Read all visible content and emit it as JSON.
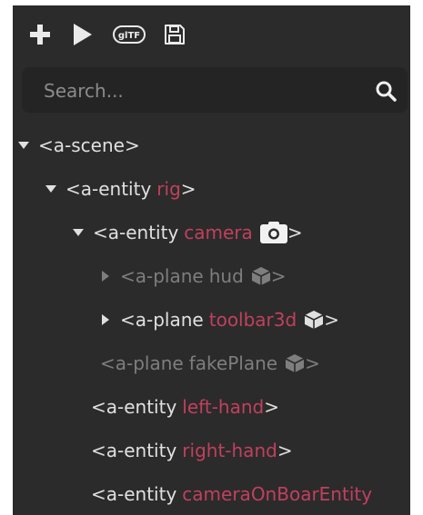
{
  "toolbar": {
    "add_icon": "plus-icon",
    "play_icon": "play-icon",
    "gltf_icon_text": "glTF",
    "save_icon": "floppy-disk-icon"
  },
  "search": {
    "placeholder": "Search..."
  },
  "tree": {
    "nodes": [
      {
        "open": "<",
        "tag": "a-scene",
        "name": "",
        "close": ">",
        "expand": "expanded"
      },
      {
        "open": "<",
        "tag": "a-entity",
        "name": "rig",
        "close": ">",
        "expand": "expanded"
      },
      {
        "open": "<",
        "tag": "a-entity",
        "name": "camera",
        "close": ">",
        "expand": "expanded",
        "icon": "camera-icon"
      },
      {
        "open": "<",
        "tag": "a-plane",
        "name": "hud",
        "close": ">",
        "expand": "collapsed",
        "icon": "cube-icon",
        "dim": true
      },
      {
        "open": "<",
        "tag": "a-plane",
        "name": "toolbar3d",
        "close": ">",
        "expand": "collapsed",
        "icon": "cube-icon"
      },
      {
        "open": "<",
        "tag": "a-plane",
        "name": "fakePlane",
        "close": ">",
        "expand": "none",
        "icon": "cube-icon",
        "dim": true
      },
      {
        "open": "<",
        "tag": "a-entity",
        "name": "left-hand",
        "close": ">",
        "expand": "none"
      },
      {
        "open": "<",
        "tag": "a-entity",
        "name": "right-hand",
        "close": ">",
        "expand": "none"
      },
      {
        "open": "<",
        "tag": "a-entity",
        "name": "cameraOnBoarEntity",
        "close": "",
        "expand": "none"
      }
    ]
  },
  "colors": {
    "panel_bg": "#2b2b2b",
    "search_bg": "#242424",
    "name_accent": "#c1405e",
    "text": "#e0e0e0",
    "dim_text": "#7e7e7e"
  }
}
